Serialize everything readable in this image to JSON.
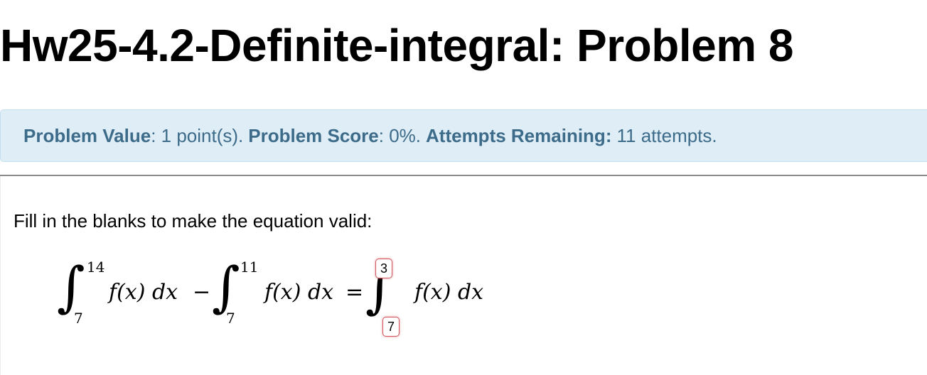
{
  "page": {
    "title": "Hw25-4.2-Definite-integral: Problem 8"
  },
  "info": {
    "value_label": "Problem Value",
    "value_text": ": 1 point(s).",
    "score_label": "Problem Score",
    "score_text": ": 0%.",
    "attempts_label": "Attempts Remaining:",
    "attempts_text": "11 attempts."
  },
  "problem": {
    "prompt": "Fill in the blanks to make the equation valid:",
    "integral1": {
      "upper": "14",
      "lower": "7"
    },
    "integral2": {
      "upper": "11",
      "lower": "7"
    },
    "integrand": "f(x) dx",
    "minus": "−",
    "equals": "=",
    "answer_upper": "3",
    "answer_lower": "7"
  },
  "colors": {
    "info_bg": "#dfedf6",
    "info_text": "#3d6b8a",
    "answer_border": "#d2565c"
  }
}
